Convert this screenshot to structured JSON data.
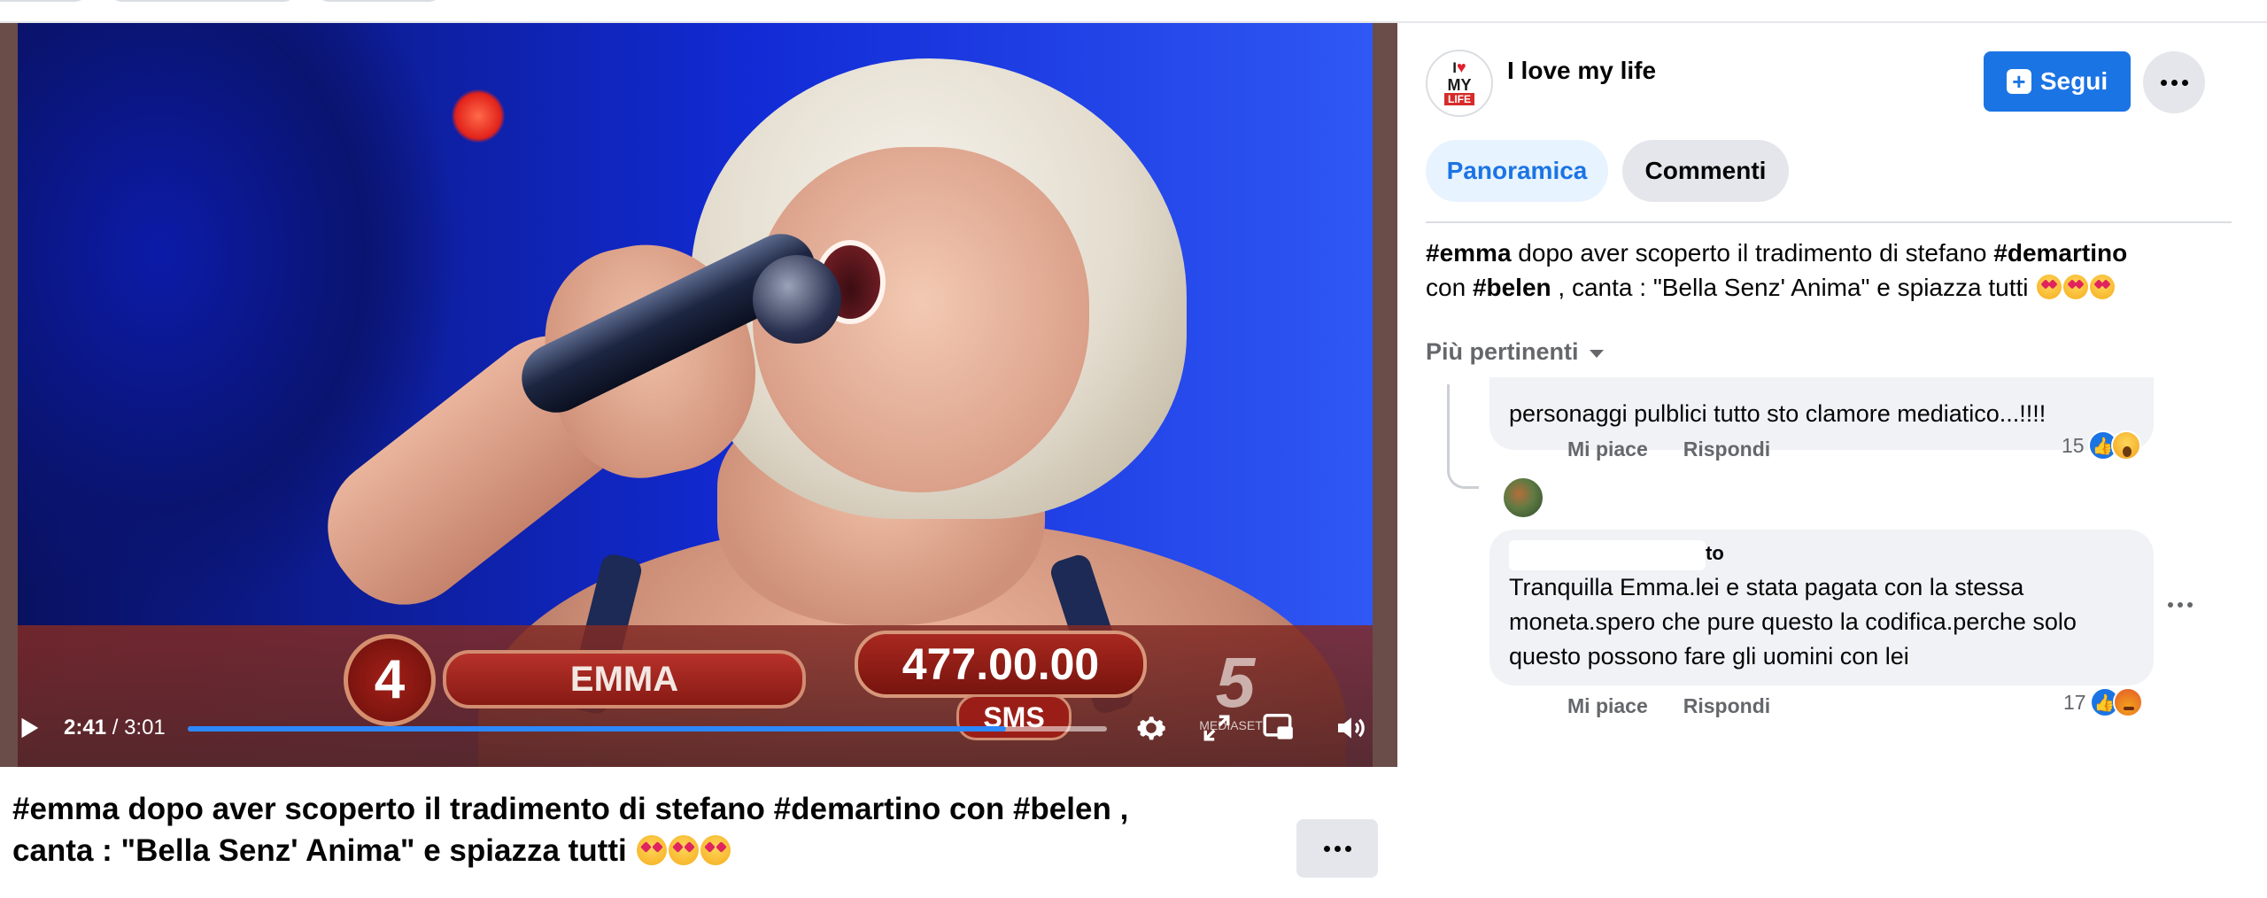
{
  "video": {
    "overlay": {
      "rank": "4",
      "name": "EMMA",
      "amount": "477.00.00",
      "tag": "SMS",
      "channel_logo": "5",
      "channel_sub": "MEDIASET"
    },
    "controls": {
      "current_time": "2:41",
      "separator": " / ",
      "total_time": "3:01",
      "progress_fraction": 0.89,
      "icons": [
        "play-icon",
        "settings-icon",
        "fullscreen-icon",
        "pip-icon",
        "volume-icon"
      ]
    },
    "caption": {
      "line1": "#emma dopo aver scoperto il tradimento di stefano #demartino con #belen ,",
      "line2": "canta : \"Bella Senz' Anima\" e spiazza tutti"
    }
  },
  "page": {
    "name": "I love my life",
    "avatar_text": {
      "i": "I",
      "heart": "♥",
      "my": "MY",
      "life": "LIFE"
    },
    "follow_label": "Segui"
  },
  "tabs": [
    {
      "label": "Panoramica",
      "active": true
    },
    {
      "label": "Commenti",
      "active": false
    }
  ],
  "post": {
    "tag1": "#emma",
    "text1": " dopo aver scoperto il tradimento di stefano ",
    "tag2": "#demartino",
    "text2": "con ",
    "tag3": "#belen",
    "text3": " , canta : \"Bella Senz' Anima\" e spiazza tutti"
  },
  "sort_label": "Più pertinenti",
  "comments": [
    {
      "text": "personaggi pulblici tutto sto clamore mediatico...!!!!",
      "like_label": "Mi piace",
      "reply_label": "Rispondi",
      "reaction_count": "15",
      "reactions": [
        "like",
        "wow"
      ]
    },
    {
      "author_tail": "to",
      "text": "Tranquilla Emma.lei e stata pagata con la stessa moneta.spero che pure questo la codifica.perche solo questo possono fare gli uomini con lei",
      "like_label": "Mi piace",
      "reply_label": "Rispondi",
      "reaction_count": "17",
      "reactions": [
        "like",
        "angry"
      ]
    }
  ],
  "colors": {
    "accent": "#1b74e4",
    "tab_active_bg": "#e7f3ff",
    "bubble_bg": "#f0f2f5",
    "secondary_text": "#65676b"
  }
}
